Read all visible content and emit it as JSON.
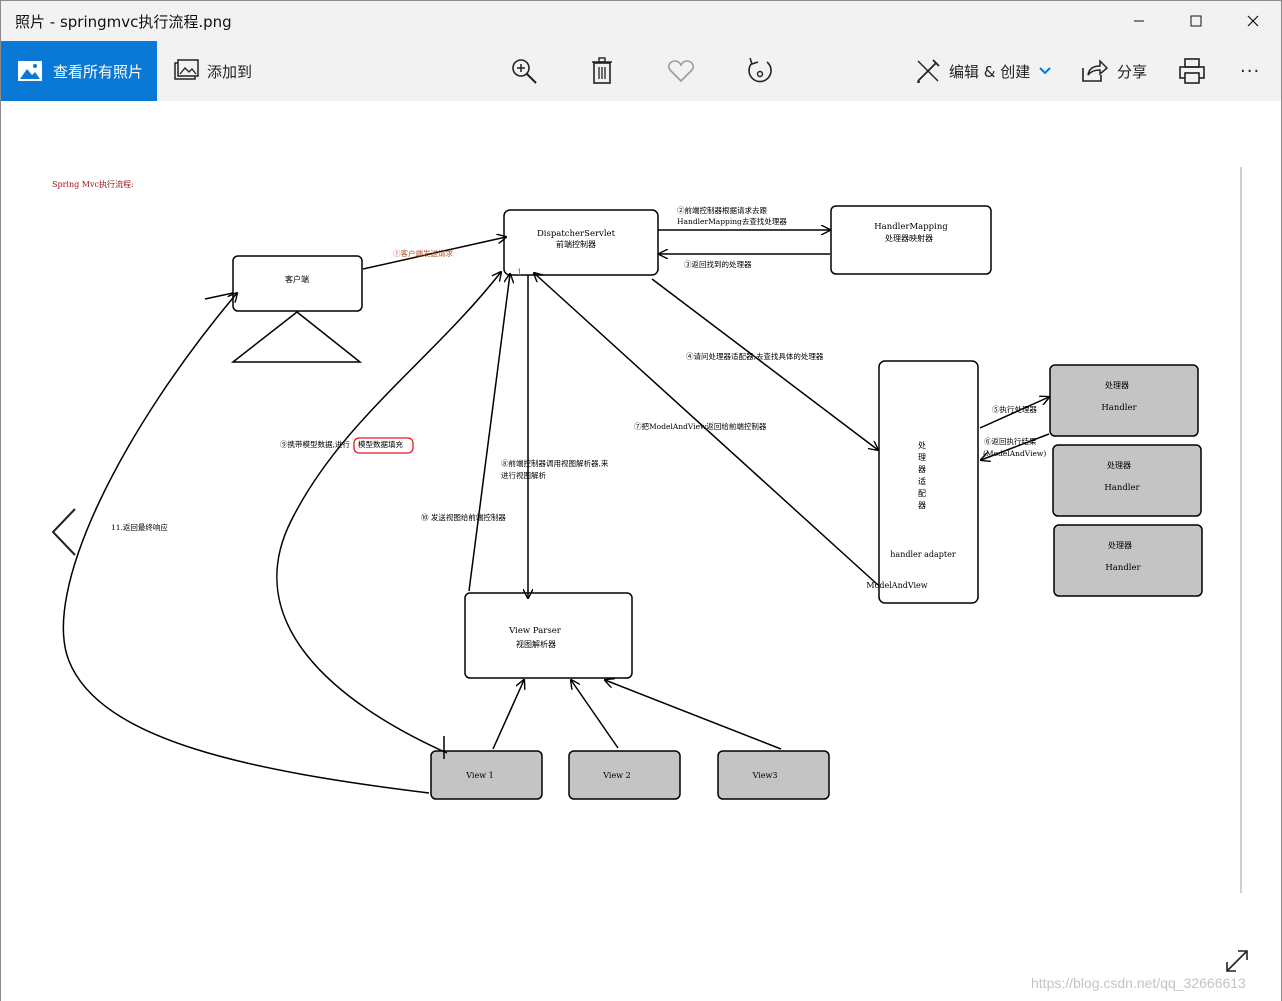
{
  "window": {
    "title": "照片 - springmvc执行流程.png"
  },
  "toolbar": {
    "all_photos_label": "查看所有照片",
    "add_to_label": "添加到",
    "edit_create_label": "编辑 & 创建",
    "share_label": "分享",
    "more_label": "···"
  },
  "diagram": {
    "heading": "Spring Mvc执行流程:",
    "nodes": {
      "client": "客户端",
      "dispatcher_en": "DispatcherServlet",
      "dispatcher_cn": "前端控制器",
      "mapping_en": "HandlerMapping",
      "mapping_cn": "处理器映射器",
      "adapter_cn": [
        "处",
        "理",
        "器",
        "适",
        "配",
        "器"
      ],
      "adapter_en": "handler adapter",
      "adapter_mav": "ModelAndView",
      "handler_cn": "处理器",
      "handler_en": "Handler",
      "resolver_en": "View Parser",
      "resolver_cn": "视图解析器",
      "view1": "View 1",
      "view2": "View 2",
      "view3": "View3"
    },
    "steps": {
      "s1": "①客户端发送请求",
      "s2a": "②前端控制器根据请求去跟",
      "s2b": "HandlerMapping去查找处理器",
      "s3": "③返回找到的处理器",
      "s4": "④请问处理器适配器,去查找具体的处理器",
      "s5": "⑤执行处理器",
      "s6a": "⑥返回执行结果",
      "s6b": "(ModelAndView)",
      "s7": "⑦把ModelAndView返回给前端控制器",
      "s8a": "⑧前端控制器调用视图解析器,来",
      "s8b": "进行视图解析",
      "s9a": "⑨携带模型数据,进行",
      "s9b": "模型数据填充",
      "s10": "⑩ 发送视图给前端控制器",
      "s11": "11.返回最终响应",
      "marker": "1"
    }
  },
  "watermark": "https://blog.csdn.net/qq_32666613",
  "colors": {
    "accent": "#0a78d7",
    "titlebar": "#f2f2f2",
    "node_fill_grey": "#c4c4c4",
    "step_text_orange": "#b7512a",
    "heading_red": "#a0161a",
    "highlight_red": "#e0191c"
  }
}
